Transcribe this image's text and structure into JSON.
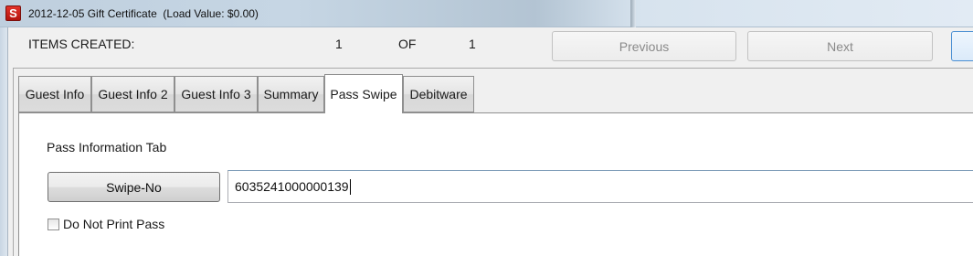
{
  "window": {
    "title": "2012-12-05 Gift Certificate  (Load Value: $0.00)",
    "icon_letter": "S"
  },
  "header": {
    "items_label": "ITEMS CREATED:",
    "current_count": "1",
    "of_label": "OF",
    "total_count": "1",
    "previous_label": "Previous",
    "next_label": "Next"
  },
  "tabs": [
    {
      "label": "Guest Info"
    },
    {
      "label": "Guest Info 2"
    },
    {
      "label": "Guest Info 3"
    },
    {
      "label": "Summary"
    },
    {
      "label": "Pass Swipe"
    },
    {
      "label": "Debitware"
    }
  ],
  "active_tab": "Pass Swipe",
  "pass_swipe": {
    "section_title": "Pass Information Tab",
    "swipe_button_label": "Swipe-No",
    "swipe_value": "6035241000000139",
    "do_not_print_label": "Do Not Print Pass",
    "do_not_print_checked": false
  },
  "colors": {
    "app_icon": "#c8221b",
    "focus_border": "#4a8fd3"
  }
}
